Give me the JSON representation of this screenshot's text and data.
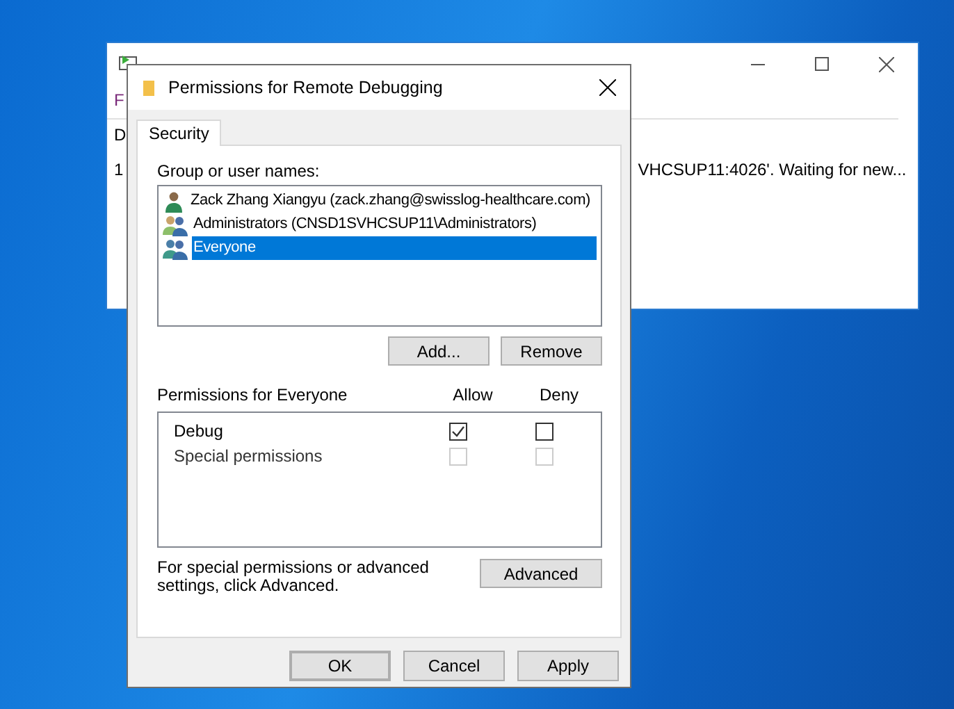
{
  "background_window": {
    "menu_fragment": "F",
    "column_fragment": "D",
    "row_start_fragment": "1",
    "row_end_fragment": "VHCSUP11:4026'. Waiting for new..."
  },
  "dialog": {
    "title": "Permissions for Remote Debugging",
    "tabs": [
      {
        "label": "Security",
        "selected": true
      }
    ],
    "group_label": "Group or user names:",
    "principals": [
      {
        "name": "Zack Zhang Xiangyu (zack.zhang@swisslog-healthcare.com)",
        "kind": "user",
        "selected": false
      },
      {
        "name": "Administrators (CNSD1SVHCSUP11\\Administrators)",
        "kind": "admins",
        "selected": false
      },
      {
        "name": "Everyone",
        "kind": "group",
        "selected": true
      }
    ],
    "list_buttons": [
      "Add...",
      "Remove"
    ],
    "permissions_label": "Permissions for Everyone",
    "columns": [
      "Allow",
      "Deny"
    ],
    "permissions": [
      {
        "name": "Debug",
        "allow": {
          "checked": true,
          "disabled": false
        },
        "deny": {
          "checked": false,
          "disabled": false
        }
      },
      {
        "name": "Special permissions",
        "allow": {
          "checked": false,
          "disabled": true
        },
        "deny": {
          "checked": false,
          "disabled": true
        }
      }
    ],
    "advanced_text": "For special permissions or advanced settings, click Advanced.",
    "advanced_button": "Advanced",
    "footer_buttons": [
      {
        "label": "OK",
        "default": true
      },
      {
        "label": "Cancel",
        "default": false
      },
      {
        "label": "Apply",
        "default": false
      }
    ]
  }
}
